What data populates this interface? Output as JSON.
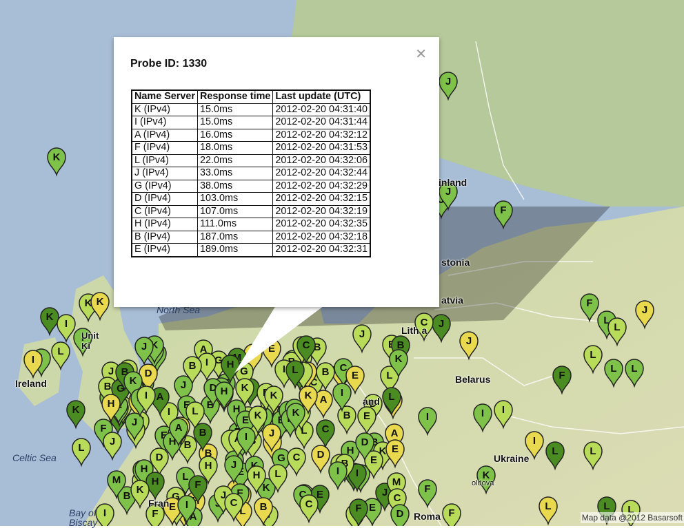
{
  "popup": {
    "title": "Probe ID: 1330",
    "close_icon": "close-icon",
    "table": {
      "headers": [
        "Name Server",
        "Response time",
        "Last update (UTC)"
      ],
      "rows": [
        [
          "K (IPv4)",
          "15.0ms",
          "2012-02-20 04:31:40"
        ],
        [
          "I (IPv4)",
          "15.0ms",
          "2012-02-20 04:31:44"
        ],
        [
          "A (IPv4)",
          "16.0ms",
          "2012-02-20 04:32:12"
        ],
        [
          "F (IPv4)",
          "18.0ms",
          "2012-02-20 04:31:53"
        ],
        [
          "L (IPv4)",
          "22.0ms",
          "2012-02-20 04:32:06"
        ],
        [
          "J (IPv4)",
          "33.0ms",
          "2012-02-20 04:32:44"
        ],
        [
          "G (IPv4)",
          "38.0ms",
          "2012-02-20 04:32:29"
        ],
        [
          "D (IPv4)",
          "103.0ms",
          "2012-02-20 04:32:15"
        ],
        [
          "C (IPv4)",
          "107.0ms",
          "2012-02-20 04:32:19"
        ],
        [
          "H (IPv4)",
          "111.0ms",
          "2012-02-20 04:32:35"
        ],
        [
          "B (IPv4)",
          "187.0ms",
          "2012-02-20 04:32:18"
        ],
        [
          "E (IPv4)",
          "189.0ms",
          "2012-02-20 04:32:31"
        ]
      ]
    }
  },
  "map": {
    "places": {
      "ireland": "Ireland",
      "belarus": "Belarus",
      "ukraine": "Ukraine",
      "finland": "inland",
      "estonia": "stonia",
      "latvia": "atvia",
      "lithuania": "Lith  a",
      "uk": "Unit\nKi",
      "france": "Fran",
      "poland": "and",
      "moldova": "oldova",
      "romania": "Roma"
    },
    "seas": {
      "north_sea": "North Sea",
      "celtic_sea": "Celtic Sea",
      "bay": "Bay of\nBiscay"
    },
    "copyright": "Map data @2012 Basarsoft",
    "colors": {
      "sea": "#a9bfd9",
      "land": "#d3d9ad",
      "forest": "#b9cc95",
      "pin_green": "#7fc24a",
      "pin_yellow": "#e8d94f",
      "pin_lime": "#b8dc5a",
      "pin_dark": "#4b8c22"
    },
    "marker_letters": [
      "A",
      "B",
      "C",
      "D",
      "E",
      "F",
      "G",
      "H",
      "I",
      "J",
      "K",
      "L",
      "M"
    ]
  }
}
